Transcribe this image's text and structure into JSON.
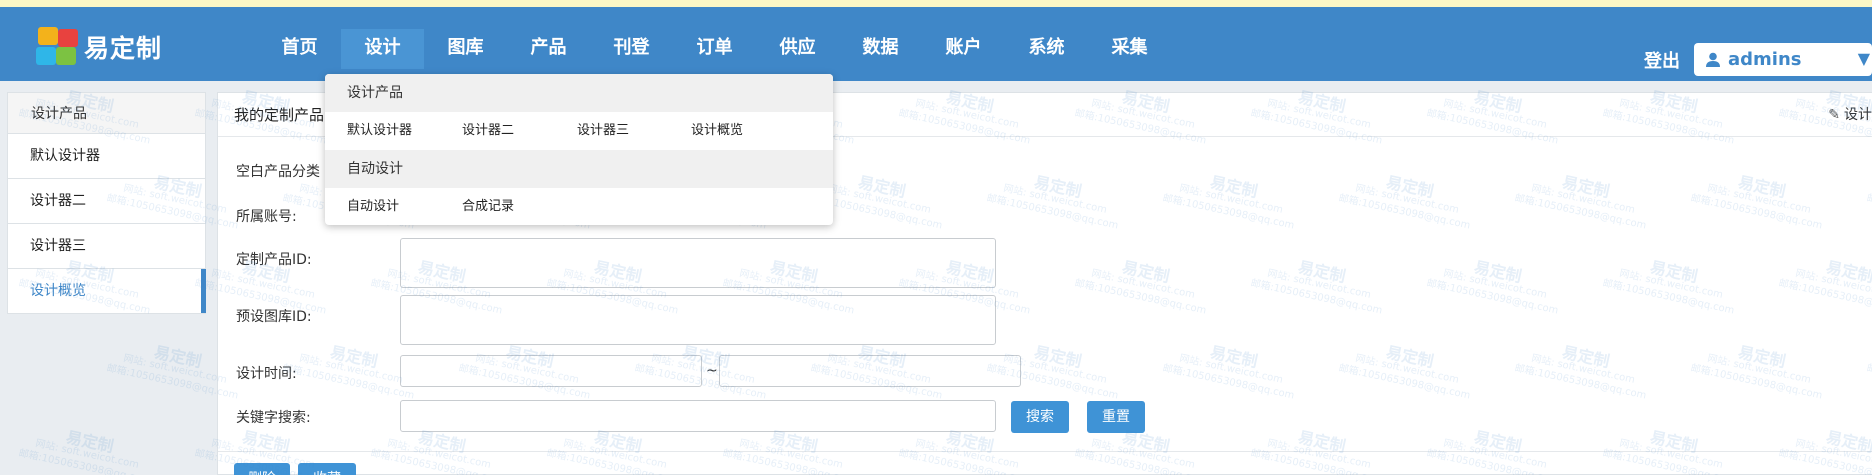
{
  "brand": {
    "name": "易定制"
  },
  "nav": {
    "items": [
      "首页",
      "设计",
      "图库",
      "产品",
      "刊登",
      "订单",
      "供应",
      "数据",
      "账户",
      "系统",
      "采集"
    ],
    "active_index": 1,
    "logout_label": "登出",
    "username": "admins",
    "user_icon": "user-icon",
    "caret_icon": "caret-down-icon"
  },
  "dropdown": {
    "group1_title": "设计产品",
    "group1_links": [
      "默认设计器",
      "设计器二",
      "设计器三",
      "设计概览"
    ],
    "group2_title": "自动设计",
    "group2_links": [
      "自动设计",
      "合成记录"
    ]
  },
  "sidebar": {
    "header": "设计产品",
    "items": [
      "默认设计器",
      "设计器二",
      "设计器三",
      "设计概览"
    ],
    "active_index": 3
  },
  "main": {
    "title": "我的定制产品",
    "head_action": "设计",
    "head_action_icon": "pencil-icon"
  },
  "form": {
    "blank_category_label": "空白产品分类",
    "account_label": "所属账号:",
    "product_id_label": "定制产品ID:",
    "gallery_id_label": "预设图库ID:",
    "design_time_label": "设计时间:",
    "time_separator": "~",
    "keyword_label": "关键字搜索:",
    "search_button": "搜索",
    "reset_button": "重置",
    "delete_button": "删除",
    "favorite_button": "收藏"
  },
  "watermark": {
    "title": "易定制",
    "site": "网站: soft.weicot.com",
    "email": "邮箱:1050653098@qq.com"
  },
  "colors": {
    "navbar": "#3f87c8",
    "accent": "#3f93d6",
    "top_strip": "#fbf7c6"
  }
}
